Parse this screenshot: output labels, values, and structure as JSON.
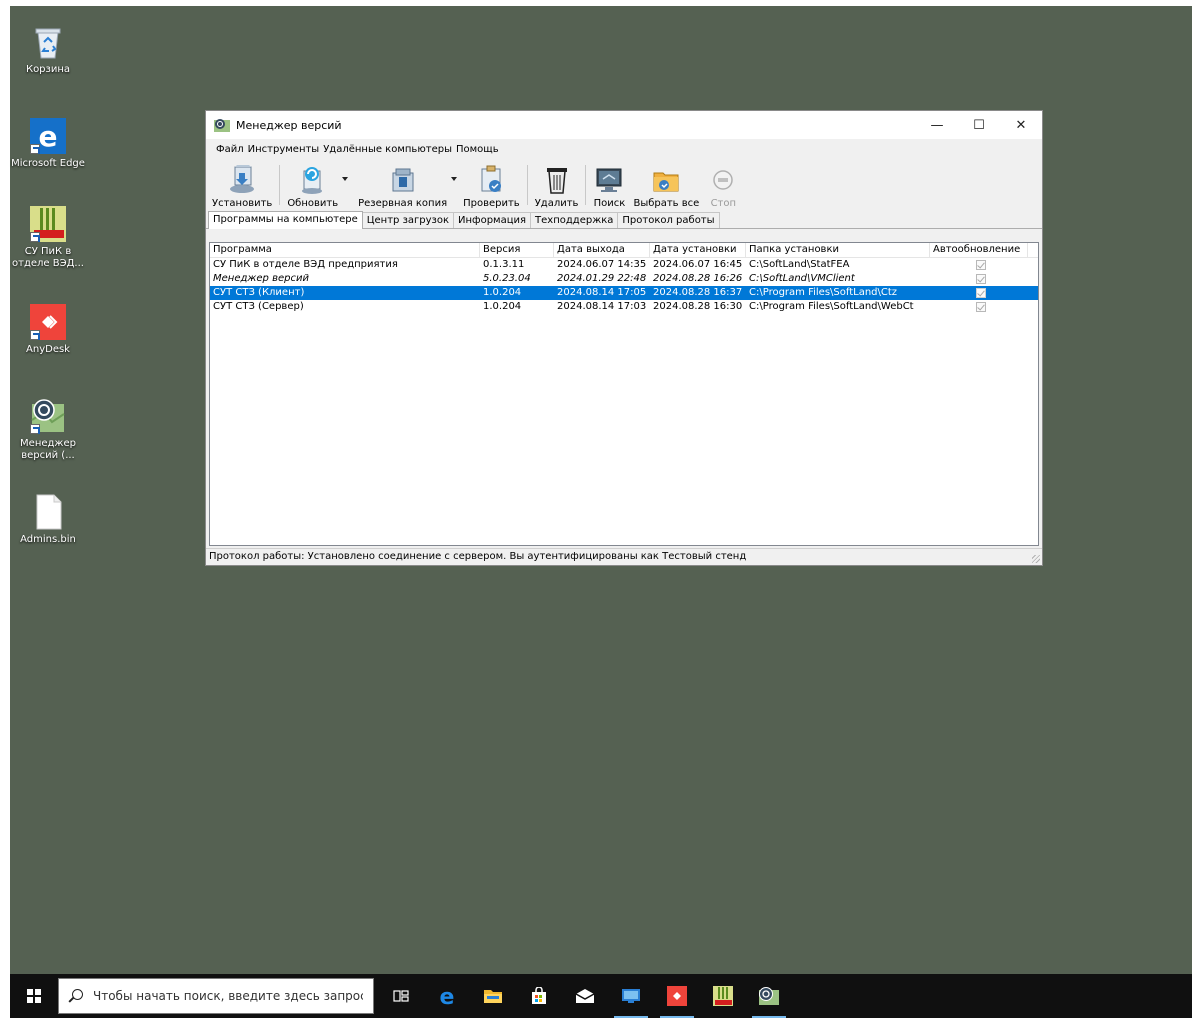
{
  "desktop": {
    "icons": [
      {
        "label": "Корзина"
      },
      {
        "label": "Microsoft Edge"
      },
      {
        "label": "СУ ПиК в отделе ВЭД..."
      },
      {
        "label": "AnyDesk"
      },
      {
        "label": "Менеджер версий (..."
      },
      {
        "label": "Admins.bin"
      }
    ]
  },
  "window": {
    "title": "Менеджер версий",
    "minimize": "—",
    "maximize": "☐",
    "close": "✕",
    "menu": [
      "Файл",
      "Инструменты",
      "Удалённые компьютеры",
      "Помощь"
    ],
    "toolbar": [
      {
        "label": "Установить"
      },
      {
        "label": "Обновить"
      },
      {
        "label": "Резервная копия"
      },
      {
        "label": "Проверить"
      },
      {
        "label": "Удалить"
      },
      {
        "label": "Поиск"
      },
      {
        "label": "Выбрать все"
      },
      {
        "label": "Стоп"
      }
    ],
    "tabs": [
      "Программы на компьютере",
      "Центр загрузок",
      "Информация",
      "Техподдержка",
      "Протокол работы"
    ],
    "table": {
      "headers": [
        "Программа",
        "Версия",
        "Дата выхода",
        "Дата установки",
        "Папка установки",
        "Автообновление"
      ],
      "rows": [
        {
          "program": "СУ ПиК в отделе ВЭД предприятия",
          "version": "0.1.3.11",
          "release": "2024.06.07 14:35",
          "installed": "2024.06.07 16:45",
          "folder": "C:\\SoftLand\\StatFEA"
        },
        {
          "program": "Менеджер версий",
          "version": "5.0.23.04",
          "release": "2024.01.29 22:48",
          "installed": "2024.08.28 16:26",
          "folder": "C:\\SoftLand\\VMClient"
        },
        {
          "program": "СУТ СТЗ (Клиент)",
          "version": "1.0.204",
          "release": "2024.08.14 17:05",
          "installed": "2024.08.28 16:37",
          "folder": "C:\\Program Files\\SoftLand\\Ctz"
        },
        {
          "program": "СУТ СТЗ (Сервер)",
          "version": "1.0.204",
          "release": "2024.08.14 17:03",
          "installed": "2024.08.28 16:30",
          "folder": "C:\\Program Files\\SoftLand\\WebCt"
        }
      ]
    },
    "status": "Протокол работы: Установлено соединение с сервером. Вы аутентифицированы как  Тестовый стенд"
  },
  "taskbar": {
    "search_placeholder": "Чтобы начать поиск, введите здесь запрос"
  },
  "colors": {
    "desktop": "#556152",
    "selection": "#0078d7",
    "taskbar": "#101010"
  }
}
